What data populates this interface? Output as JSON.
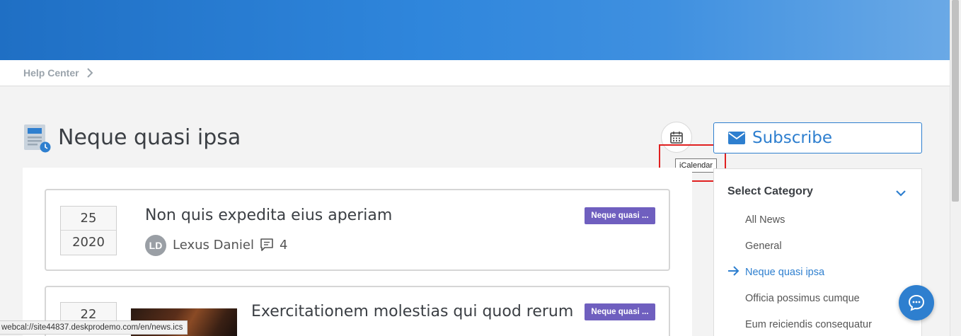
{
  "breadcrumb": {
    "items": [
      "Help Center"
    ]
  },
  "page": {
    "title": "Neque quasi ipsa"
  },
  "calendar": {
    "tooltip": "iCalendar",
    "icon": "calendar-icon"
  },
  "subscribe": {
    "label": "Subscribe",
    "icon": "envelope-icon"
  },
  "articles": [
    {
      "day": "25",
      "year": "2020",
      "title": "Non quis expedita eius aperiam",
      "tag": "Neque quasi ...",
      "author_initials": "LD",
      "author": "Lexus Daniel",
      "comments": "4"
    },
    {
      "day": "22",
      "title": "Exercitationem molestias qui quod rerum",
      "tag": "Neque quasi ..."
    }
  ],
  "sidebar": {
    "heading": "Select Category",
    "items": [
      {
        "label": "All News",
        "active": false
      },
      {
        "label": "General",
        "active": false
      },
      {
        "label": "Neque quasi ipsa",
        "active": true
      },
      {
        "label": "Officia possimus cumque",
        "active": false
      },
      {
        "label": "Eum reiciendis consequatur",
        "active": false
      }
    ]
  },
  "status": {
    "url": "webcal://site44837.deskprodemo.com/en/news.ics"
  },
  "colors": {
    "accent": "#2e7fcf",
    "tag": "#6f5fbf",
    "highlight": "#e02020"
  }
}
